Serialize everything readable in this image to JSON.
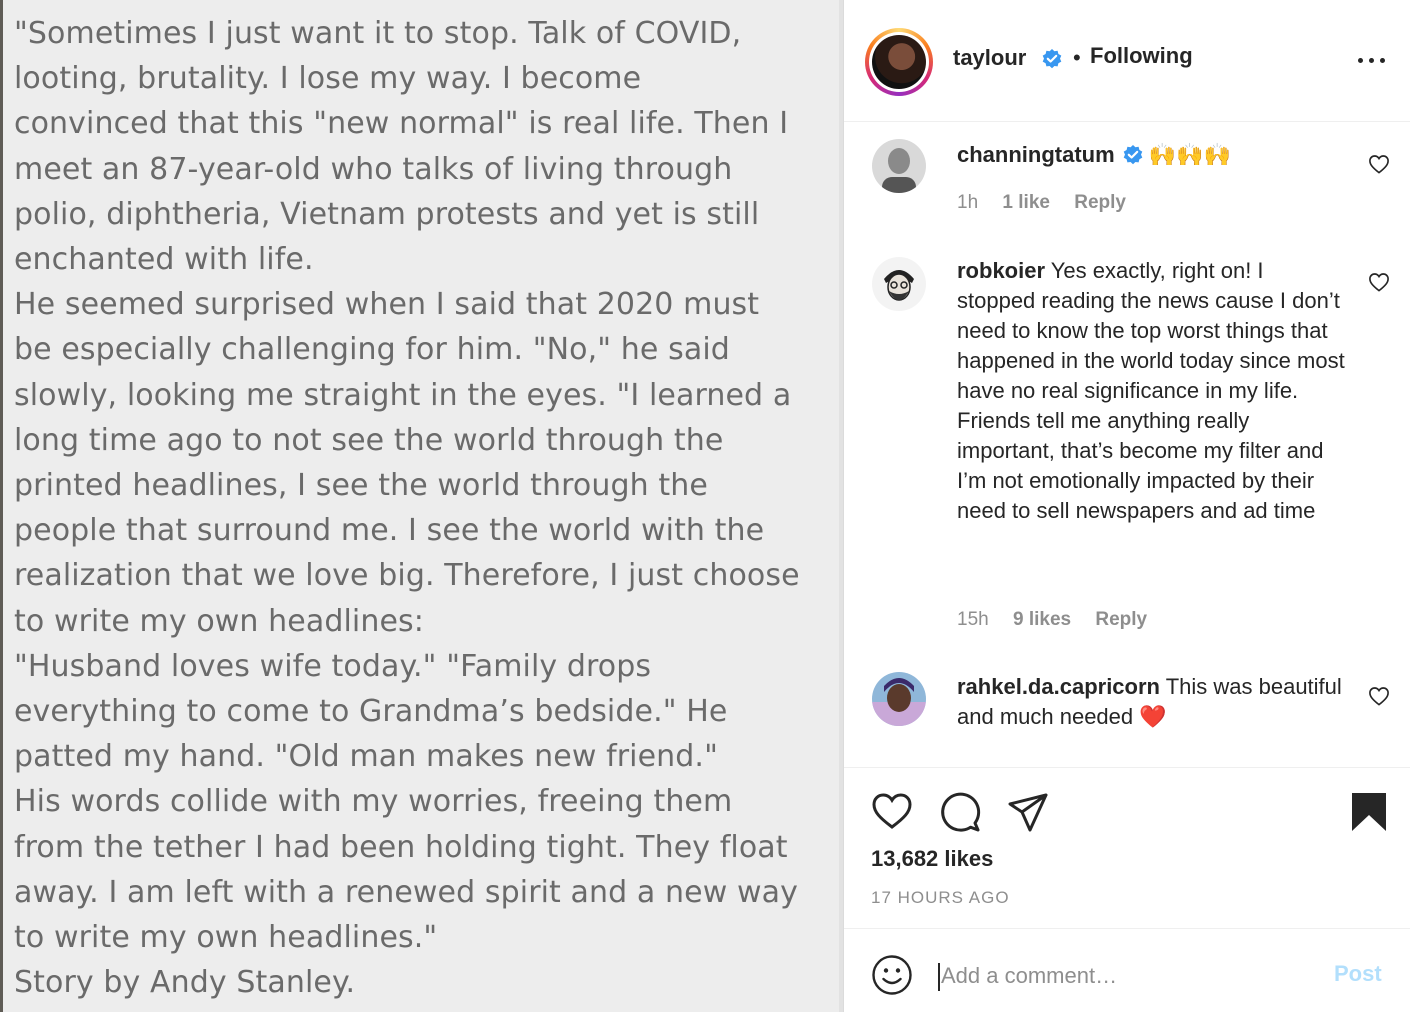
{
  "post": {
    "text_lines": [
      "\"Sometimes I just want it to stop. Talk of COVID,",
      "looting, brutality. I lose my way. I become",
      "convinced that this \"new normal\" is real life. Then I",
      "meet an 87-year-old who talks of living through",
      "polio, diphtheria, Vietnam protests and yet is still",
      "enchanted with life.",
      "He seemed surprised when I said that 2020 must",
      "be especially challenging for him. \"No,\" he said",
      "slowly, looking me straight in the eyes. \"I learned a",
      "long time ago to not see the world through the",
      "printed headlines, I see the world through the",
      "people that surround me. I see the world with the",
      "realization that we love big. Therefore, I just choose",
      "to write my own headlines:",
      "\"Husband loves wife today.\" \"Family drops",
      "everything to come to Grandma’s bedside.\" He",
      "patted my hand. \"Old man makes new friend.\"",
      "His words collide with my worries, freeing them",
      "from the tether I had been holding tight. They float",
      "away. I am left with a renewed spirit and a new way",
      "to write my own headlines.\"",
      "Story by Andy Stanley."
    ]
  },
  "header": {
    "username": "taylour",
    "separator": "•",
    "follow_state": "Following",
    "more_icon": "more-horizontal-icon",
    "verified_icon": "verified-badge-icon"
  },
  "comments": [
    {
      "username": "channingtatum",
      "verified": true,
      "text": "🙌🙌🙌",
      "time": "1h",
      "likes": "1 like",
      "reply": "Reply"
    },
    {
      "username": "robkoier",
      "verified": false,
      "text": "Yes exactly, right on! I stopped reading the news cause I don’t need to know the top worst things that happened in the world today since most have no real significance in my life. Friends tell me anything really important, that’s become my filter and I’m not emotionally impacted by their need to sell newspapers and ad time",
      "time": "15h",
      "likes": "9 likes",
      "reply": "Reply"
    },
    {
      "username": "rahkel.da.capricorn",
      "verified": false,
      "text": "This was beautiful and much needed ❤️"
    }
  ],
  "actions": {
    "icons": [
      "heart-icon",
      "comment-icon",
      "share-icon",
      "bookmark-icon"
    ],
    "likes": "13,682 likes",
    "time_ago": "17 HOURS AGO"
  },
  "add_comment": {
    "placeholder": "Add a comment…",
    "post_label": "Post"
  },
  "colors": {
    "verified": "#3897f0",
    "post_disabled": "#b2dffc",
    "muted": "#8e8e8e",
    "heart_emoji": "#e0245e"
  }
}
